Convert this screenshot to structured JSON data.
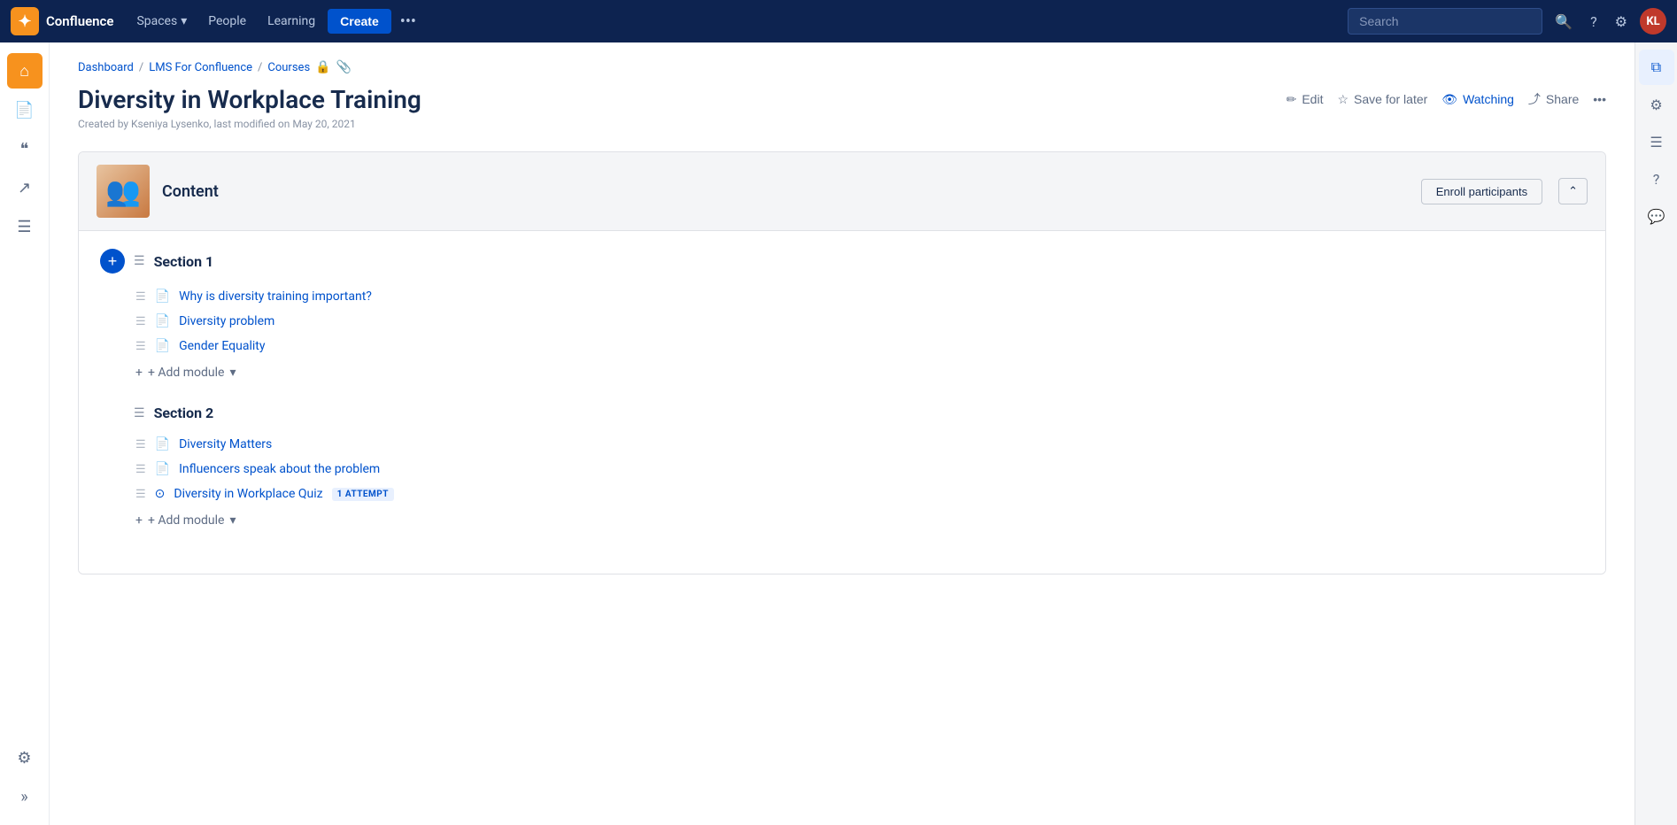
{
  "topnav": {
    "logo_letter": "✦",
    "brand": "Confluence",
    "nav_items": [
      {
        "label": "Spaces",
        "has_dropdown": true
      },
      {
        "label": "People",
        "has_dropdown": false
      },
      {
        "label": "Learning",
        "has_dropdown": false
      }
    ],
    "create_label": "Create",
    "more_label": "•••",
    "search_placeholder": "Search",
    "help_icon": "?",
    "settings_icon": "⚙",
    "avatar_initials": "KL"
  },
  "sidebar": {
    "icons": [
      {
        "name": "home",
        "glyph": "⌂",
        "active": true
      },
      {
        "name": "document",
        "glyph": "📄",
        "active": false
      },
      {
        "name": "quote",
        "glyph": "❝",
        "active": false
      },
      {
        "name": "export",
        "glyph": "↗",
        "active": false
      },
      {
        "name": "tasks",
        "glyph": "☰",
        "active": false
      }
    ],
    "bottom_icon": "⚙",
    "expand_icon": "»"
  },
  "right_panel": {
    "icons": [
      {
        "name": "copy",
        "glyph": "⧉",
        "active": true
      },
      {
        "name": "gear",
        "glyph": "⚙"
      },
      {
        "name": "list",
        "glyph": "☰"
      },
      {
        "name": "help",
        "glyph": "?"
      },
      {
        "name": "comment",
        "glyph": "💬"
      }
    ]
  },
  "breadcrumb": {
    "items": [
      "Dashboard",
      "LMS For Confluence",
      "Courses"
    ],
    "lock_icon": "🔒",
    "link_icon": "🔗"
  },
  "page": {
    "title": "Diversity in Workplace Training",
    "meta": "Created by Kseniya Lysenko, last modified on May 20, 2021",
    "actions": {
      "edit": "Edit",
      "save_for_later": "Save for later",
      "watching": "Watching",
      "share": "Share",
      "more": "•••"
    }
  },
  "content_box": {
    "thumbnail_emoji": "👥",
    "header_title": "Content",
    "enroll_btn": "Enroll participants",
    "collapse_icon": "⌃",
    "sections": [
      {
        "title": "Section 1",
        "modules": [
          {
            "type": "page",
            "label": "Why is diversity training important?"
          },
          {
            "type": "page",
            "label": "Diversity problem"
          },
          {
            "type": "page",
            "label": "Gender Equality"
          }
        ],
        "add_module_label": "+ Add module"
      },
      {
        "title": "Section 2",
        "modules": [
          {
            "type": "page",
            "label": "Diversity Matters"
          },
          {
            "type": "page",
            "label": "Influencers speak about the problem"
          },
          {
            "type": "quiz",
            "label": "Diversity in Workplace Quiz",
            "badge": "1 ATTEMPT"
          }
        ],
        "add_module_label": "+ Add module"
      }
    ]
  }
}
